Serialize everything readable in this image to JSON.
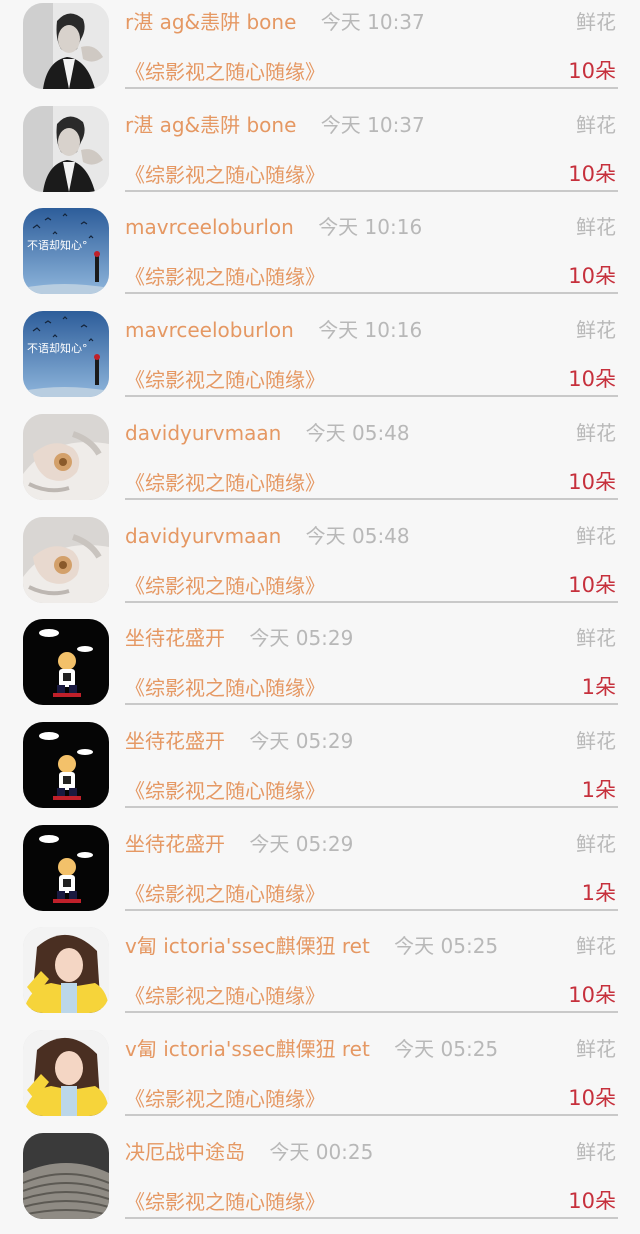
{
  "gift_list": [
    {
      "name": "r湛 ag&恚阱 bone",
      "time": "今天 10:37",
      "gift_type": "鲜花",
      "work_title": "《综影视之随心随缘》",
      "quantity": "10朵",
      "avatar": "man-bw-icon"
    },
    {
      "name": "r湛 ag&恚阱 bone",
      "time": "今天 10:37",
      "gift_type": "鲜花",
      "work_title": "《综影视之随心随缘》",
      "quantity": "10朵",
      "avatar": "man-bw-icon"
    },
    {
      "name": "mavrceeloburlon",
      "time": "今天 10:16",
      "gift_type": "鲜花",
      "work_title": "《综影视之随心随缘》",
      "quantity": "10朵",
      "avatar": "sky-text-icon",
      "avatar_text": "不语却知心°"
    },
    {
      "name": "mavrceeloburlon",
      "time": "今天 10:16",
      "gift_type": "鲜花",
      "work_title": "《综影视之随心随缘》",
      "quantity": "10朵",
      "avatar": "sky-text-icon",
      "avatar_text": "不语却知心°"
    },
    {
      "name": "davidyurvmaan",
      "time": "今天 05:48",
      "gift_type": "鲜花",
      "work_title": "《综影视之随心随缘》",
      "quantity": "10朵",
      "avatar": "hand-art-icon"
    },
    {
      "name": "davidyurvmaan",
      "time": "今天 05:48",
      "gift_type": "鲜花",
      "work_title": "《综影视之随心随缘》",
      "quantity": "10朵",
      "avatar": "hand-art-icon"
    },
    {
      "name": "坐待花盛开",
      "time": "今天 05:29",
      "gift_type": "鲜花",
      "work_title": "《综影视之随心随缘》",
      "quantity": "1朵",
      "avatar": "cartoon-boy-icon"
    },
    {
      "name": "坐待花盛开",
      "time": "今天 05:29",
      "gift_type": "鲜花",
      "work_title": "《综影视之随心随缘》",
      "quantity": "1朵",
      "avatar": "cartoon-boy-icon"
    },
    {
      "name": "坐待花盛开",
      "time": "今天 05:29",
      "gift_type": "鲜花",
      "work_title": "《综影视之随心随缘》",
      "quantity": "1朵",
      "avatar": "cartoon-boy-icon"
    },
    {
      "name": "v匐 ictoria'ssec麒傈狃 ret",
      "time": "今天 05:25",
      "gift_type": "鲜花",
      "work_title": "《综影视之随心随缘》",
      "quantity": "10朵",
      "avatar": "girl-yellow-icon"
    },
    {
      "name": "v匐 ictoria'ssec麒傈狃 ret",
      "time": "今天 05:25",
      "gift_type": "鲜花",
      "work_title": "《综影视之随心随缘》",
      "quantity": "10朵",
      "avatar": "girl-yellow-icon"
    },
    {
      "name": "决厄战中途岛",
      "time": "今天 00:25",
      "gift_type": "鲜花",
      "work_title": "《综影视之随心随缘》",
      "quantity": "10朵",
      "avatar": "stone-texture-icon"
    }
  ],
  "colors": {
    "name_orange": "#e59863",
    "quantity_red": "#c6303c",
    "muted_gray": "#b9b9b9",
    "background": "#f7f7f7"
  }
}
